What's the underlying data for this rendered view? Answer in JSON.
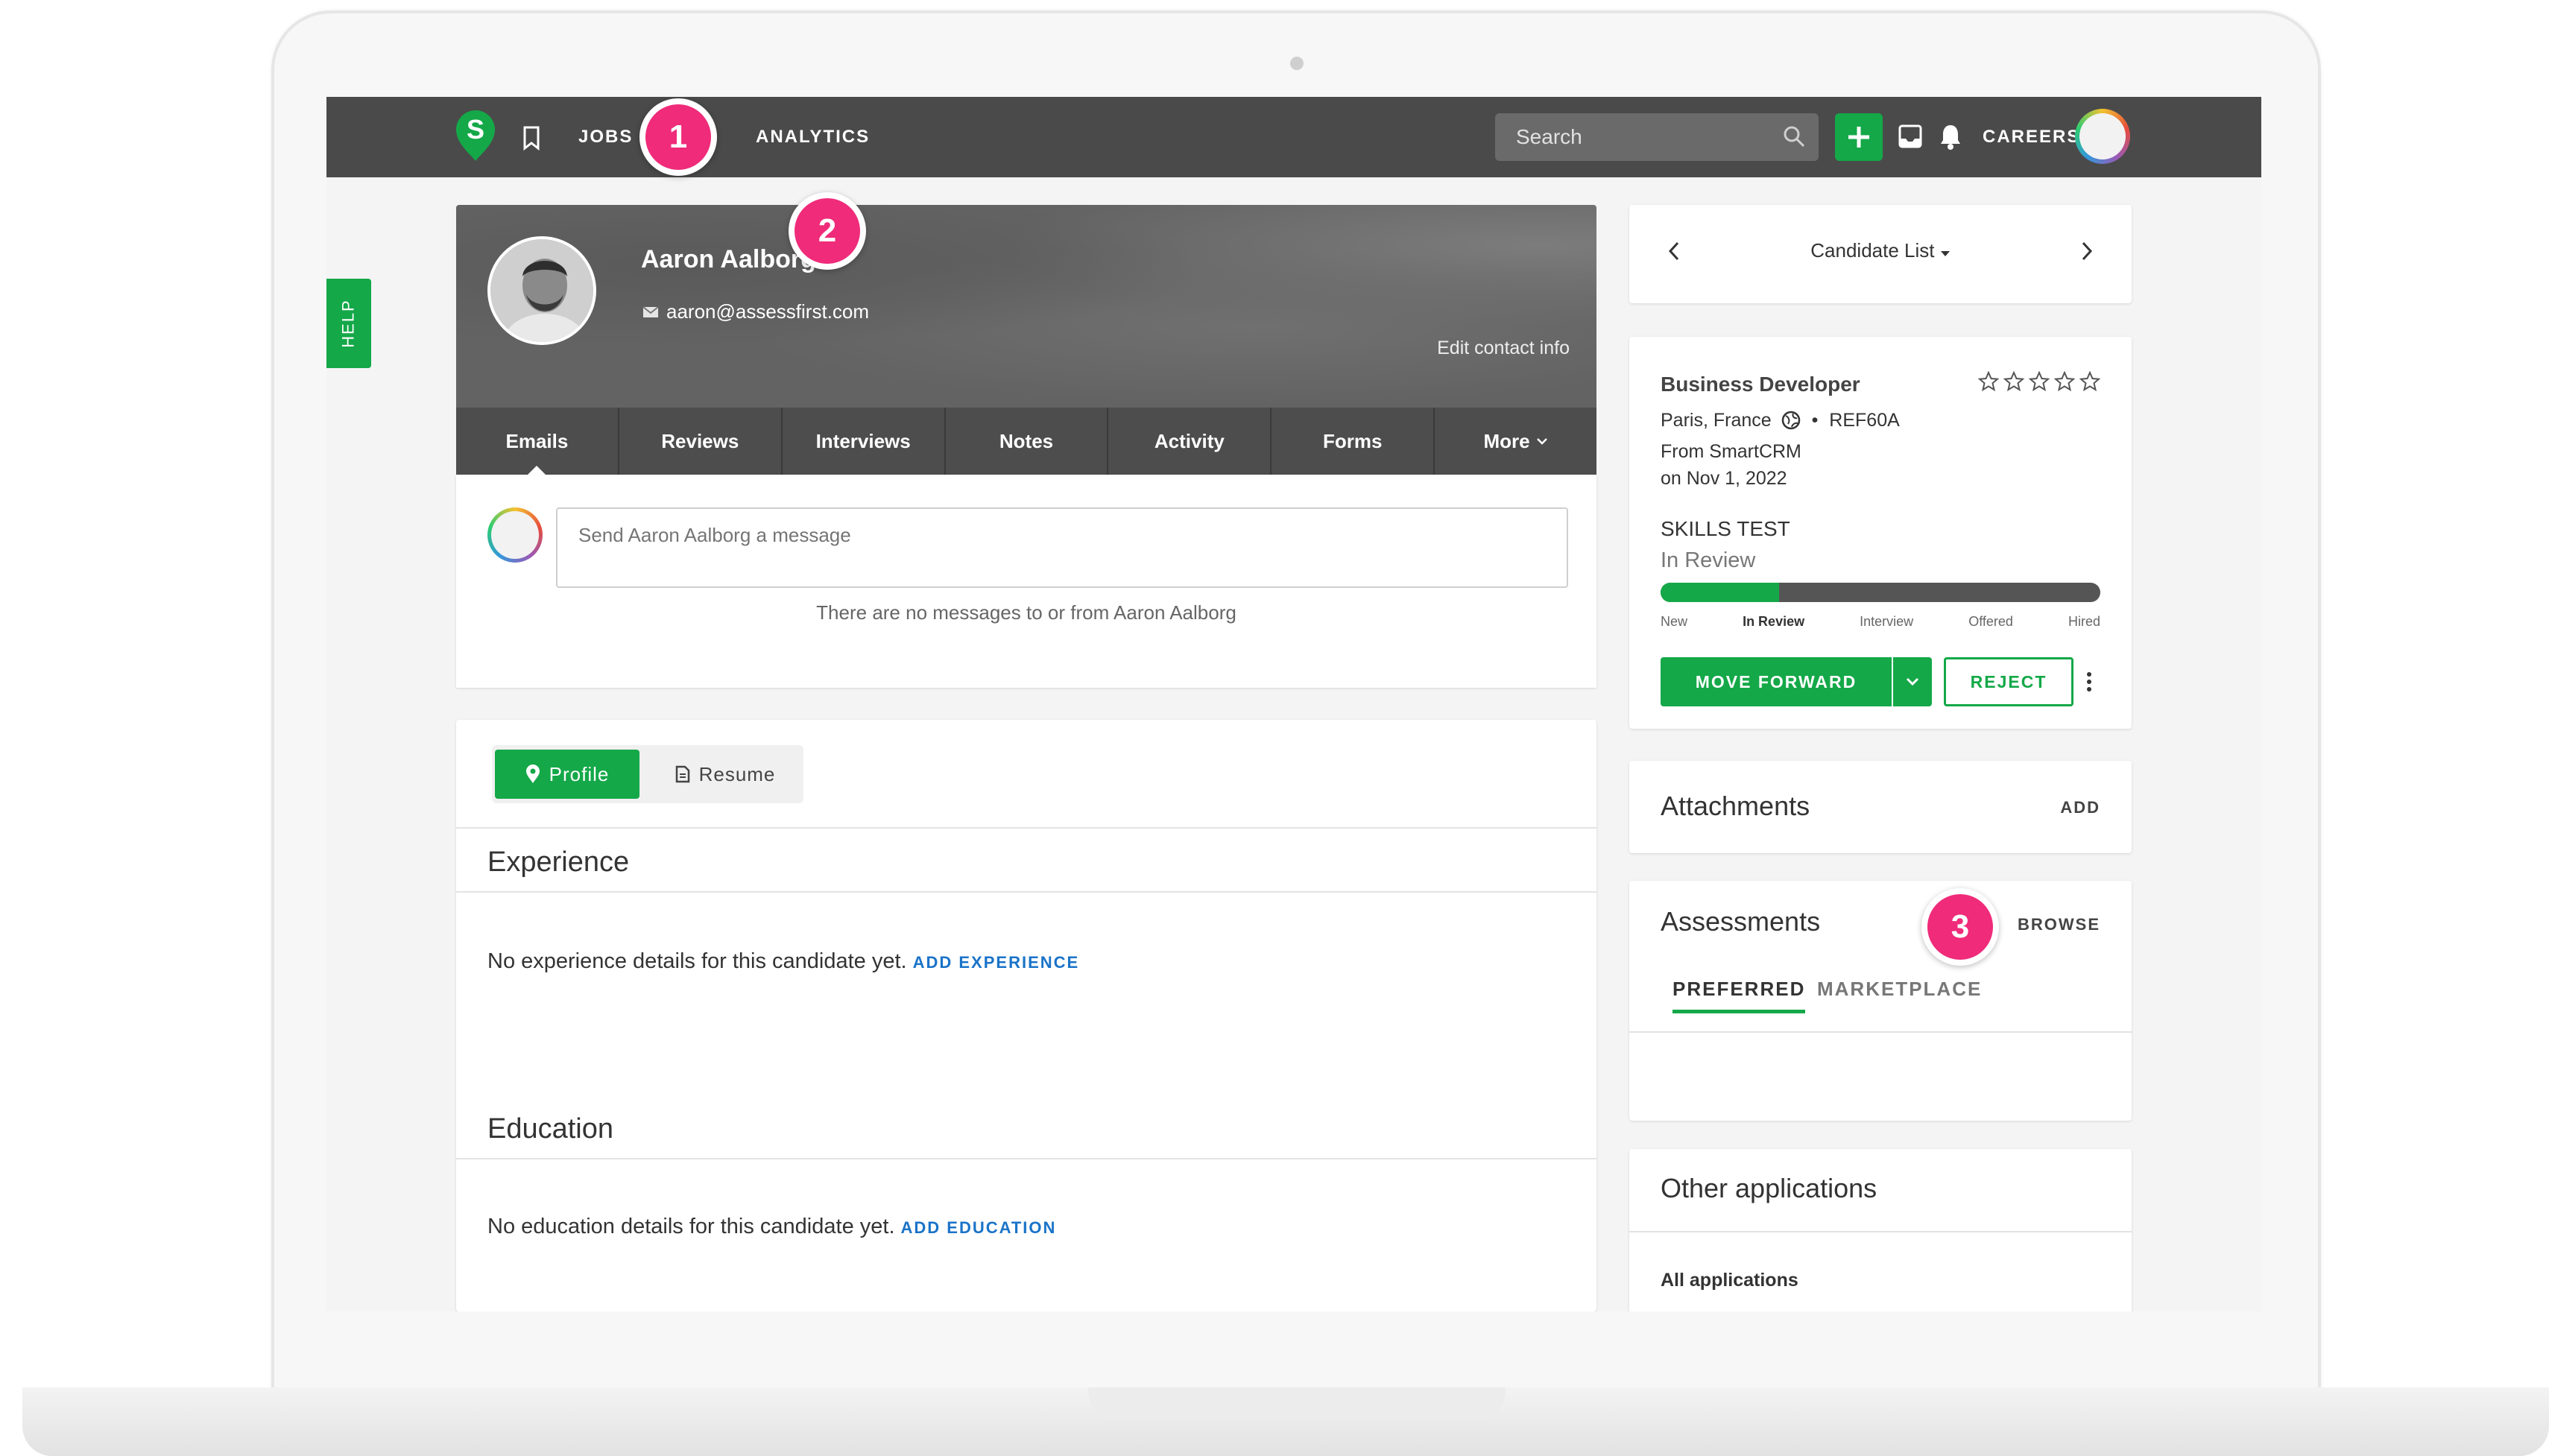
{
  "nav": {
    "logo_letter": "S",
    "jobs": "JOBS",
    "analytics": "ANALYTICS",
    "search_placeholder": "Search",
    "careers": "CAREERS"
  },
  "markers": [
    "1",
    "2",
    "3"
  ],
  "help_label": "HELP",
  "candidate": {
    "name": "Aaron Aalborg",
    "email": "aaron@assessfirst.com",
    "edit_contact": "Edit contact info"
  },
  "profile_tabs": [
    "Emails",
    "Reviews",
    "Interviews",
    "Notes",
    "Activity",
    "Forms",
    "More"
  ],
  "messages": {
    "placeholder": "Send Aaron Aalborg a message",
    "empty_text": "There are no messages to or from Aaron Aalborg"
  },
  "profile_section": {
    "toggle_profile": "Profile",
    "toggle_resume": "Resume",
    "experience_title": "Experience",
    "experience_empty": "No experience details for this candidate yet.",
    "add_experience": "ADD EXPERIENCE",
    "education_title": "Education",
    "education_empty": "No education details for this candidate yet.",
    "add_education": "ADD EDUCATION"
  },
  "candidate_list": "Candidate List",
  "job": {
    "title": "Business Developer",
    "location": "Paris, France",
    "ref": "REF60A",
    "source": "From SmartCRM",
    "date": "on Nov 1, 2022",
    "rating_max": 5,
    "rating": 0,
    "stage_group": "SKILLS TEST",
    "current_stage": "In Review",
    "progress_fraction": 0.27,
    "stages": [
      "New",
      "In Review",
      "Interview",
      "Offered",
      "Hired"
    ],
    "move_forward": "MOVE FORWARD",
    "reject": "REJECT"
  },
  "attachments": {
    "title": "Attachments",
    "action": "ADD"
  },
  "assessments": {
    "title": "Assessments",
    "action": "BROWSE",
    "tab_preferred": "PREFERRED",
    "tab_marketplace": "MARKETPLACE"
  },
  "other_applications": {
    "title": "Other applications",
    "all_label": "All applications"
  },
  "colors": {
    "brand_green": "#14a848",
    "marker_pink": "#ef2b7a",
    "nav_bg": "#4a4a4a",
    "link_blue": "#1a73c8"
  }
}
